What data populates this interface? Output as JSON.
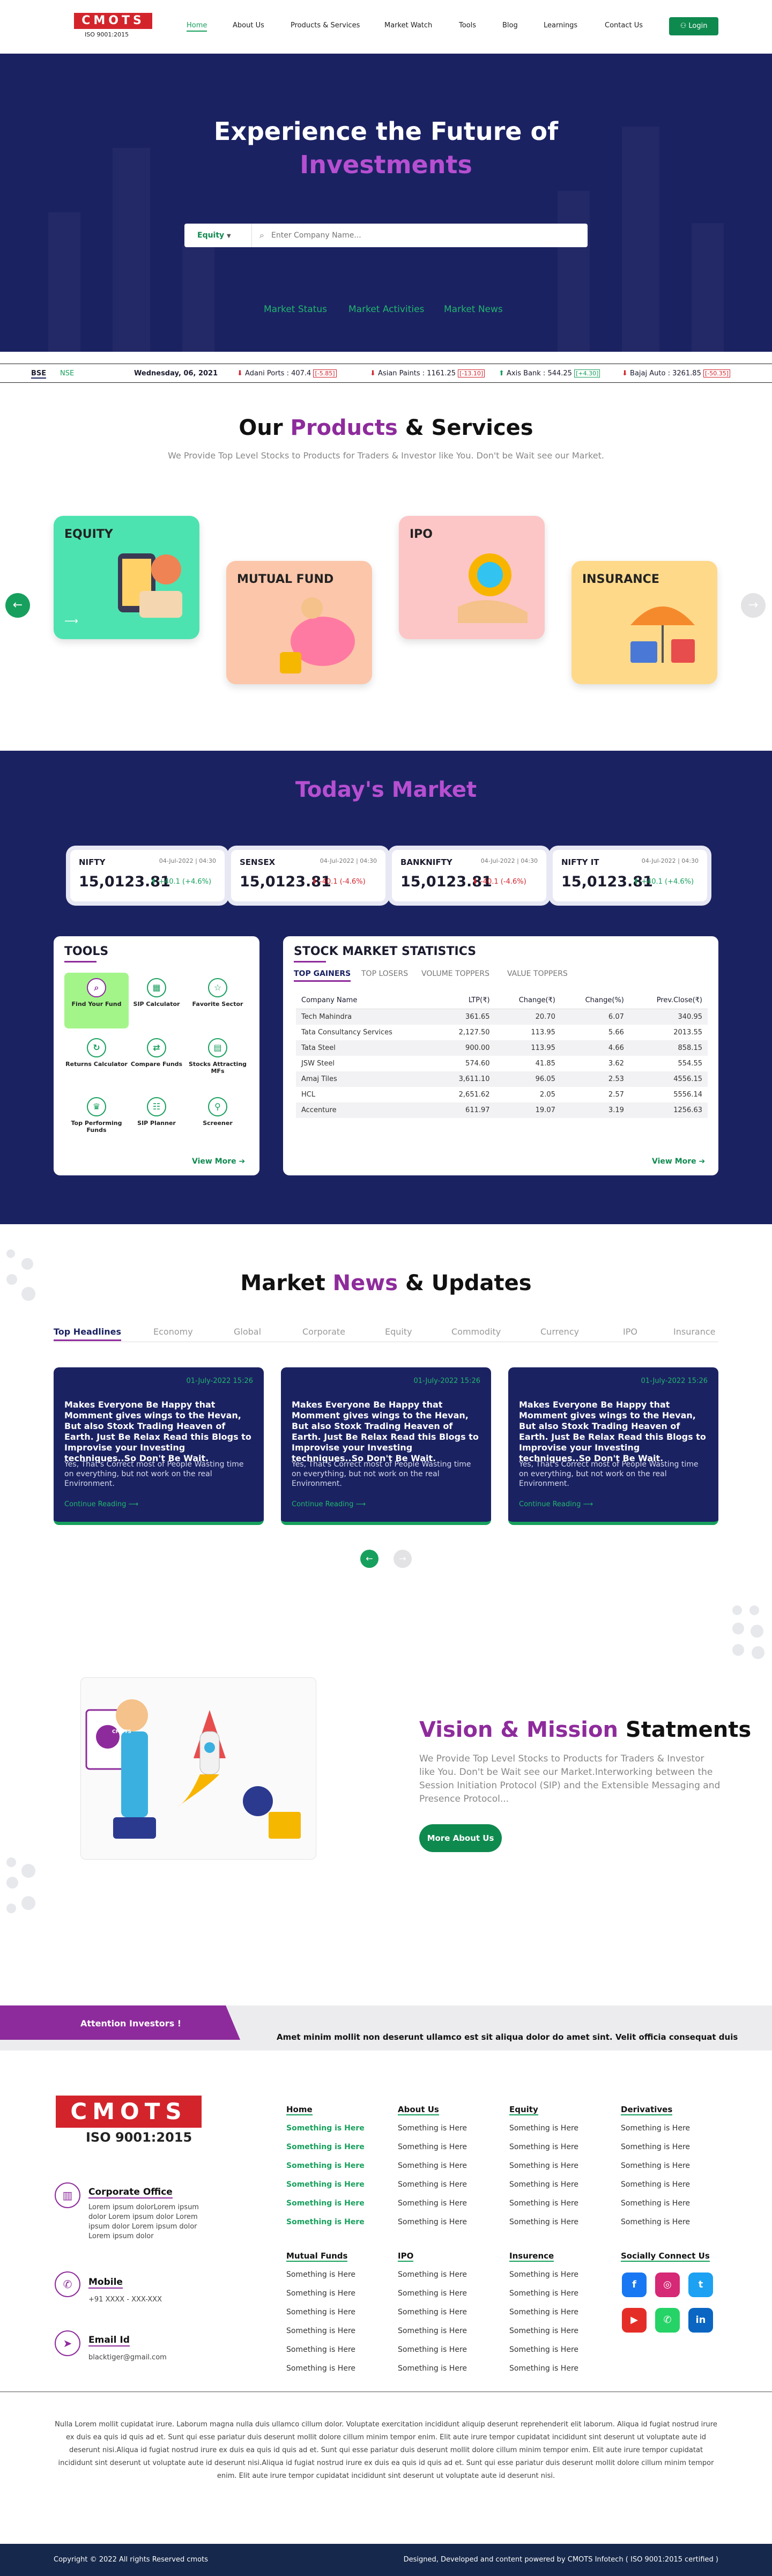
{
  "header": {
    "logo": "CMOTS",
    "logo_sub": "ISO 9001:2015",
    "nav": [
      "Home",
      "About Us",
      "Products & Services",
      "Market Watch",
      "Tools",
      "Blog",
      "Learnings",
      "Contact Us"
    ],
    "login": "Login"
  },
  "hero": {
    "title_line1": "Experience the Future of",
    "title_line2": "Investments",
    "search_type": "Equity",
    "search_placeholder": "Enter Company Name...",
    "tabs": [
      "Market Status",
      "Market Activities",
      "Market News"
    ]
  },
  "ticker": {
    "exchange_tabs": [
      "BSE",
      "NSE"
    ],
    "date": "Wednesday, 06, 2021",
    "items": [
      {
        "text": "Adani Ports : 407.4",
        "change": "[-5.85]",
        "dir": "down"
      },
      {
        "text": "Asian Paints : 1161.25",
        "change": "[-13.10]",
        "dir": "down"
      },
      {
        "text": "Axis Bank : 544.25",
        "change": "[+4.30]",
        "dir": "up"
      },
      {
        "text": "Bajaj Auto : 3261.85",
        "change": "[-50.35]",
        "dir": "down"
      }
    ]
  },
  "products": {
    "title_a": "Our ",
    "title_b": "Products",
    "title_c": " & Services",
    "subtitle": "We Provide Top Level Stocks to Products for Traders & Investor like You. Don't be Wait see our Market.",
    "cards": [
      "EQUITY",
      "MUTUAL FUND",
      "IPO",
      "INSURANCE"
    ],
    "prev_icon": "arrow-left",
    "next_icon": "arrow-right"
  },
  "market": {
    "title": "Today's Market",
    "indices": [
      {
        "name": "NIFTY",
        "date": "04-Jul-2022 | 04:30",
        "value": "15,0123.81",
        "change": "+40.1 (+4.6%)",
        "dir": "up"
      },
      {
        "name": "SENSEX",
        "date": "04-Jul-2022 | 04:30",
        "value": "15,0123.81",
        "change": "-40.1 (-4.6%)",
        "dir": "down"
      },
      {
        "name": "BANKNIFTY",
        "date": "04-Jul-2022 | 04:30",
        "value": "15,0123.81",
        "change": "-40.1 (-4.6%)",
        "dir": "down"
      },
      {
        "name": "NIFTY IT",
        "date": "04-Jul-2022 | 04:30",
        "value": "15,0123.81",
        "change": "+40.1 (+4.6%)",
        "dir": "up"
      }
    ],
    "tools_title": "TOOLS",
    "tools": [
      "Find Your Fund",
      "SIP Calculator",
      "Favorite Sector",
      "Returns Calculator",
      "Compare Funds",
      "Stocks Attracting MFs",
      "Top Performing Funds",
      "SIP Planner",
      "Screener"
    ],
    "tools_view_more": "View More",
    "stats_title": "STOCK MARKET STATISTICS",
    "stats_tabs": [
      "TOP GAINERS",
      "TOP LOSERS",
      "VOLUME TOPPERS",
      "VALUE TOPPERS"
    ],
    "stats_columns": [
      "Company Name",
      "LTP(₹)",
      "Change(₹)",
      "Change(%)",
      "Prev.Close(₹)"
    ],
    "stats_rows": [
      [
        "Tech Mahindra",
        "361.65",
        "20.70",
        "6.07",
        "340.95"
      ],
      [
        "Tata Consultancy Services",
        "2,127.50",
        "113.95",
        "5.66",
        "2013.55"
      ],
      [
        "Tata Steel",
        "900.00",
        "113.95",
        "4.66",
        "858.15"
      ],
      [
        "JSW Steel",
        "574.60",
        "41.85",
        "3.62",
        "554.55"
      ],
      [
        "Amaj Tiles",
        "3,611.10",
        "96.05",
        "2.53",
        "4556.15"
      ],
      [
        "HCL",
        "2,651.62",
        "2.05",
        "2.57",
        "5556.14"
      ],
      [
        "Accenture",
        "611.97",
        "19.07",
        "3.19",
        "1256.63"
      ]
    ],
    "stats_view_more": "View More"
  },
  "news": {
    "title_a": "Market ",
    "title_b": "News",
    "title_c": " & Updates",
    "tabs": [
      "Top Headlines",
      "Economy",
      "Global",
      "Corporate",
      "Equity",
      "Commodity",
      "Currency",
      "IPO",
      "Insurance"
    ],
    "cards": [
      {
        "date": "01-July-2022 15:26",
        "title": "Makes Everyone Be Happy that Momment gives wings to the Hevan, But also Stoxk Trading Heaven of Earth. Just Be Relax Read this Blogs to Improvise your Investing techniques..So Don't Be Wait.",
        "body": "Yes, That's Correct most of People Wasting time on everything, but not work on the real Environment.",
        "link": "Continue Reading"
      },
      {
        "date": "01-July-2022 15:26",
        "title": "Makes Everyone Be Happy that Momment gives wings to the Hevan, But also Stoxk Trading Heaven of Earth. Just Be Relax Read this Blogs to Improvise your Investing techniques..So Don't Be Wait.",
        "body": "Yes, That's Correct most of People Wasting time on everything, but not work on the real Environment.",
        "link": "Continue Reading"
      },
      {
        "date": "01-July-2022 15:26",
        "title": "Makes Everyone Be Happy that Momment gives wings to the Hevan, But also Stoxk Trading Heaven of Earth. Just Be Relax Read this Blogs to Improvise your Investing techniques..So Don't Be Wait.",
        "body": "Yes, That's Correct most of People Wasting time on everything, but not work on the real Environment.",
        "link": "Continue Reading"
      }
    ]
  },
  "vision": {
    "title_a": "Vision & Mission",
    "title_b": " Statments",
    "text": "We Provide Top Level Stocks to Products for Traders & Investor like You. Don't be Wait see our Market.Interworking between the Session Initiation Protocol (SIP) and the Extensible Messaging and Presence Protocol...",
    "button": "More About Us",
    "laptop_brand": "CMOTS"
  },
  "attention": {
    "label": "Attention Investors !",
    "text": "Amet minim mollit non deserunt ullamco est sit aliqua dolor do amet sint. Velit officia consequat duis"
  },
  "footer": {
    "logo": "CMOTS",
    "logo_sub": "ISO 9001:2015",
    "office_title": "Corporate Office",
    "office_text": "Lorem ipsum dolorLorem ipsum dolor Lorem ipsum dolor Lorem ipsum dolor Lorem ipsum dolor Lorem ipsum dolor",
    "mobile_title": "Mobile",
    "mobile_text": "+91 XXXX - XXX-XXX",
    "email_title": "Email Id",
    "email_text": "blacktiger@gmail.com",
    "columns": [
      {
        "title": "Home",
        "links": [
          "Something is Here",
          "Something is Here",
          "Something is Here",
          "Something is Here",
          "Something is Here",
          "Something is Here"
        ]
      },
      {
        "title": "About Us",
        "links": [
          "Something is Here",
          "Something is Here",
          "Something is Here",
          "Something is Here",
          "Something is Here",
          "Something is Here"
        ]
      },
      {
        "title": "Equity",
        "links": [
          "Something is Here",
          "Something is Here",
          "Something is Here",
          "Something is Here",
          "Something is Here",
          "Something is Here"
        ]
      },
      {
        "title": "Derivatives",
        "links": [
          "Something is Here",
          "Something is Here",
          "Something is Here",
          "Something is Here",
          "Something is Here",
          "Something is Here"
        ]
      },
      {
        "title": "Mutual Funds",
        "links": [
          "Something is Here",
          "Something is Here",
          "Something is Here",
          "Something is Here",
          "Something is Here",
          "Something is Here"
        ]
      },
      {
        "title": "IPO",
        "links": [
          "Something is Here",
          "Something is Here",
          "Something is Here",
          "Something is Here",
          "Something is Here",
          "Something is Here"
        ]
      },
      {
        "title": "Insurence",
        "links": [
          "Something is Here",
          "Something is Here",
          "Something is Here",
          "Something is Here",
          "Something is Here",
          "Something is Here"
        ]
      }
    ],
    "social_title": "Socially Connect Us",
    "social": [
      {
        "icon": "facebook-icon",
        "glyph": "f",
        "color": "#1877f2"
      },
      {
        "icon": "instagram-icon",
        "glyph": "◎",
        "color": "#d62976"
      },
      {
        "icon": "twitter-icon",
        "glyph": "t",
        "color": "#1da1f2"
      },
      {
        "icon": "youtube-icon",
        "glyph": "▶",
        "color": "#e52d27"
      },
      {
        "icon": "whatsapp-icon",
        "glyph": "✆",
        "color": "#25d366"
      },
      {
        "icon": "linkedin-icon",
        "glyph": "in",
        "color": "#0a66c2"
      }
    ],
    "disclaimer": "Nulla Lorem mollit cupidatat irure. Laborum magna nulla duis ullamco cillum dolor. Voluptate exercitation incididunt aliquip deserunt reprehenderit elit laborum. Aliqua id fugiat nostrud irure ex duis ea quis id quis ad et. Sunt qui esse pariatur duis deserunt mollit dolore cillum minim tempor enim. Elit aute irure tempor cupidatat incididunt sint deserunt ut voluptate aute id deserunt nisi.Aliqua id fugiat nostrud irure ex duis ea quis id quis ad et. Sunt qui esse pariatur duis deserunt mollit dolore cillum minim tempor enim. Elit aute irure tempor cupidatat incididunt sint deserunt ut voluptate aute id deserunt nisi.Aliqua id fugiat nostrud irure ex duis ea quis id quis ad et. Sunt qui esse pariatur duis deserunt mollit dolore cillum minim tempor enim. Elit aute irure tempor cupidatat incididunt sint deserunt ut voluptate aute id deserunt nisi.",
    "copyright": "Copyright © 2022 All rights Reserved cmots",
    "credit": "Designed, Developed and content powered by CMOTS Infotech ( ISO 9001:2015 certified )"
  },
  "colors": {
    "navy": "#1b2262",
    "green": "#17a05d",
    "purple": "#8e2b9c",
    "red": "#d3242c"
  }
}
